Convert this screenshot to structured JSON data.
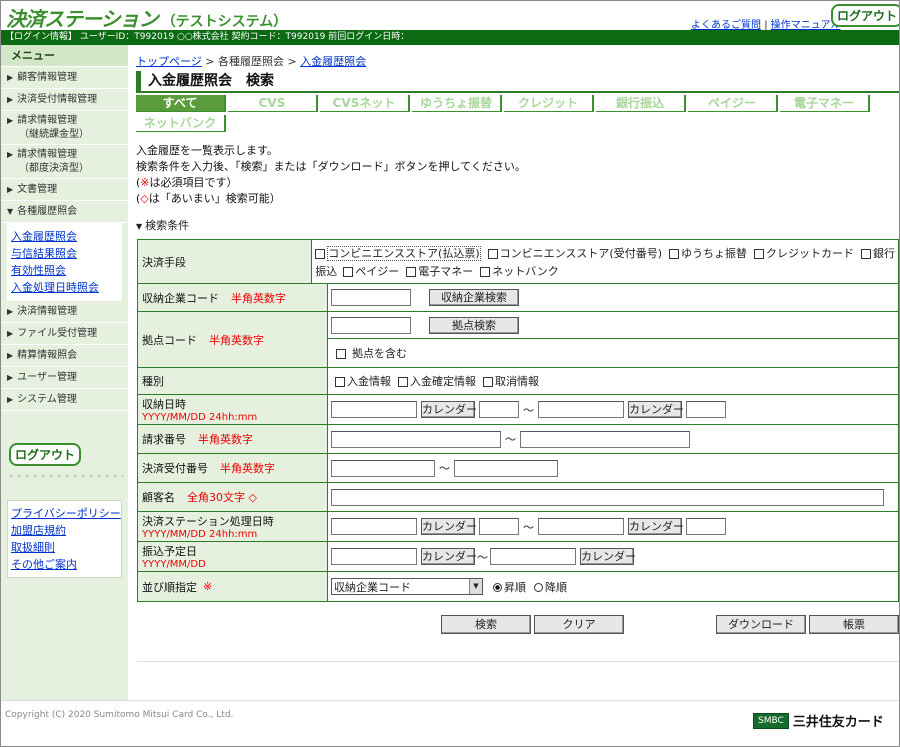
{
  "header": {
    "logo": "決済ステーション",
    "logo_sub": "（テストシステム）",
    "faq_link": "よくあるご質問",
    "separator": "|",
    "manual_link": "操作マニュアル",
    "logout": "ログアウト"
  },
  "infobar": {
    "text": "【ログイン情報】 ユーザーID：T992019 ○○株式会社 契約コード：T992019 前回ログイン日時："
  },
  "sidebar": {
    "title": "メニュー",
    "items_top": [
      {
        "label": "顧客情報管理"
      },
      {
        "label": "決済受付情報管理"
      },
      {
        "label": "請求情報管理",
        "sub": "（継続課金型）"
      },
      {
        "label": "請求情報管理",
        "sub": "（都度決済型）"
      },
      {
        "label": "文書管理"
      },
      {
        "label": "各種履歴照会",
        "open": true
      }
    ],
    "submenu": [
      "入金履歴照会",
      "与信結果照会",
      "有効性照会",
      "入金処理日時照会"
    ],
    "items_bottom": [
      {
        "label": "決済情報管理"
      },
      {
        "label": "ファイル受付管理"
      },
      {
        "label": "精算情報照会"
      },
      {
        "label": "ユーザー管理"
      },
      {
        "label": "システム管理"
      }
    ],
    "logout": "ログアウト",
    "links": [
      "プライバシーポリシー",
      "加盟店規約",
      "取扱細則",
      "その他ご案内"
    ]
  },
  "breadcrumb": {
    "top": "トップページ",
    "sep1": ">",
    "middle": "各種履歴照会",
    "sep2": ">",
    "current": "入金履歴照会"
  },
  "page_title": "入金履歴照会　検索",
  "tabs": [
    "すべて",
    "CVS",
    "CVSネット",
    "ゆうちょ振替",
    "クレジット",
    "銀行振込",
    "ペイジー",
    "電子マネー",
    "ネットバンク"
  ],
  "intro": {
    "line1": "入金履歴を一覧表示します。",
    "line2": "検索条件を入力後、「検索」または「ダウンロード」ボタンを押してください。",
    "line3_mark": "※",
    "line3_text": "は必須項目です）",
    "line3_open": "(",
    "line4_mark": "◇",
    "line4_text": "は「あいまい」検索可能）",
    "line4_open": "("
  },
  "conditions_title": "検索条件",
  "form": {
    "payment_method": {
      "label": "決済手段",
      "options": [
        "コンビニエンスストア(払込票)",
        "コンビニエンスストア(受付番号)",
        "ゆうちょ振替",
        "クレジットカード",
        "銀行"
      ],
      "options_line2_prefix": "振込",
      "options2": [
        "ペイジー",
        "電子マネー",
        "ネットバンク"
      ]
    },
    "company_code": {
      "label": "収納企業コード",
      "hint": "半角英数字",
      "button": "収納企業検索"
    },
    "branch_code": {
      "label": "拠点コード",
      "hint": "半角英数字",
      "button": "拠点検索",
      "include_label": "拠点を含む"
    },
    "type": {
      "label": "種別",
      "options": [
        "入金情報",
        "入金確定情報",
        "取消情報"
      ]
    },
    "receipt_date": {
      "label": "収納日時",
      "hint": "YYYY/MM/DD 24hh:mm",
      "calendar": "カレンダー",
      "tilde": "～"
    },
    "invoice_no": {
      "label": "請求番号",
      "hint": "半角英数字",
      "tilde": "～"
    },
    "accept_no": {
      "label": "決済受付番号",
      "hint": "半角英数字",
      "tilde": "～"
    },
    "customer_name": {
      "label": "顧客名",
      "hint": "全角30文字 ◇"
    },
    "station_date": {
      "label": "決済ステーション処理日時",
      "hint": "YYYY/MM/DD 24hh:mm",
      "calendar": "カレンダー",
      "tilde": "～"
    },
    "transfer_date": {
      "label": "振込予定日",
      "hint": "YYYY/MM/DD",
      "calendar": "カレンダー",
      "tilde": "～"
    },
    "sort": {
      "label": "並び順指定",
      "hint": "※",
      "selected": "収納企業コード",
      "asc": "昇順",
      "desc": "降順"
    }
  },
  "buttons": {
    "search": "検索",
    "clear": "クリア",
    "download": "ダウンロード",
    "report": "帳票"
  },
  "footer": {
    "copyright": "Copyright (C) 2020 Sumitomo Mitsui Card Co., Ltd.",
    "smbc_badge": "SMBC",
    "smbc_name": "三井住友カード"
  }
}
